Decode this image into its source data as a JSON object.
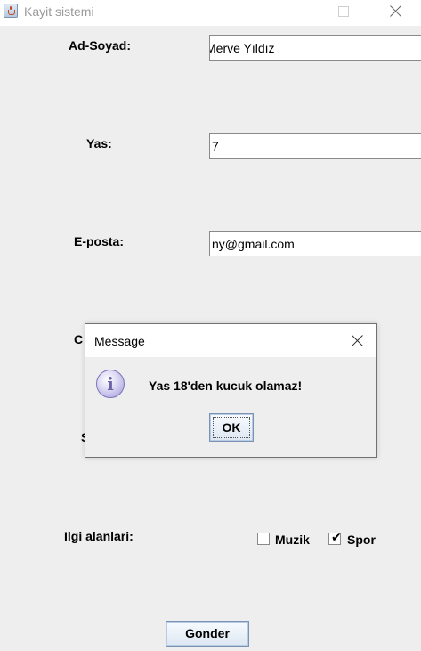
{
  "window": {
    "title": "Kayit sistemi",
    "buttons": [
      "minimize-icon",
      "maximize-icon",
      "close-icon"
    ]
  },
  "form": {
    "ad_soyad_label": "Ad-Soyad:",
    "ad_soyad_value": "Merve Yıldız",
    "yas_label": "Yas:",
    "yas_value": "7",
    "eposta_label": "E-posta:",
    "eposta_value": "ny@gmail.com",
    "hidden_label_c": "C",
    "hidden_label_s": "S",
    "ilgi_label": "Ilgi alanlari:",
    "interests": [
      {
        "label": "Muzik",
        "checked": false
      },
      {
        "label": "Spor",
        "checked": true
      }
    ],
    "submit_label": "Gonder"
  },
  "dialog": {
    "title": "Message",
    "icon": "info-icon",
    "icon_glyph": "i",
    "message": "Yas 18'den kucuk olamaz!",
    "ok_label": "OK"
  },
  "colors": {
    "background": "#eeeeee",
    "button_border": "#7a93b5",
    "info_icon": "#9e97d6"
  }
}
